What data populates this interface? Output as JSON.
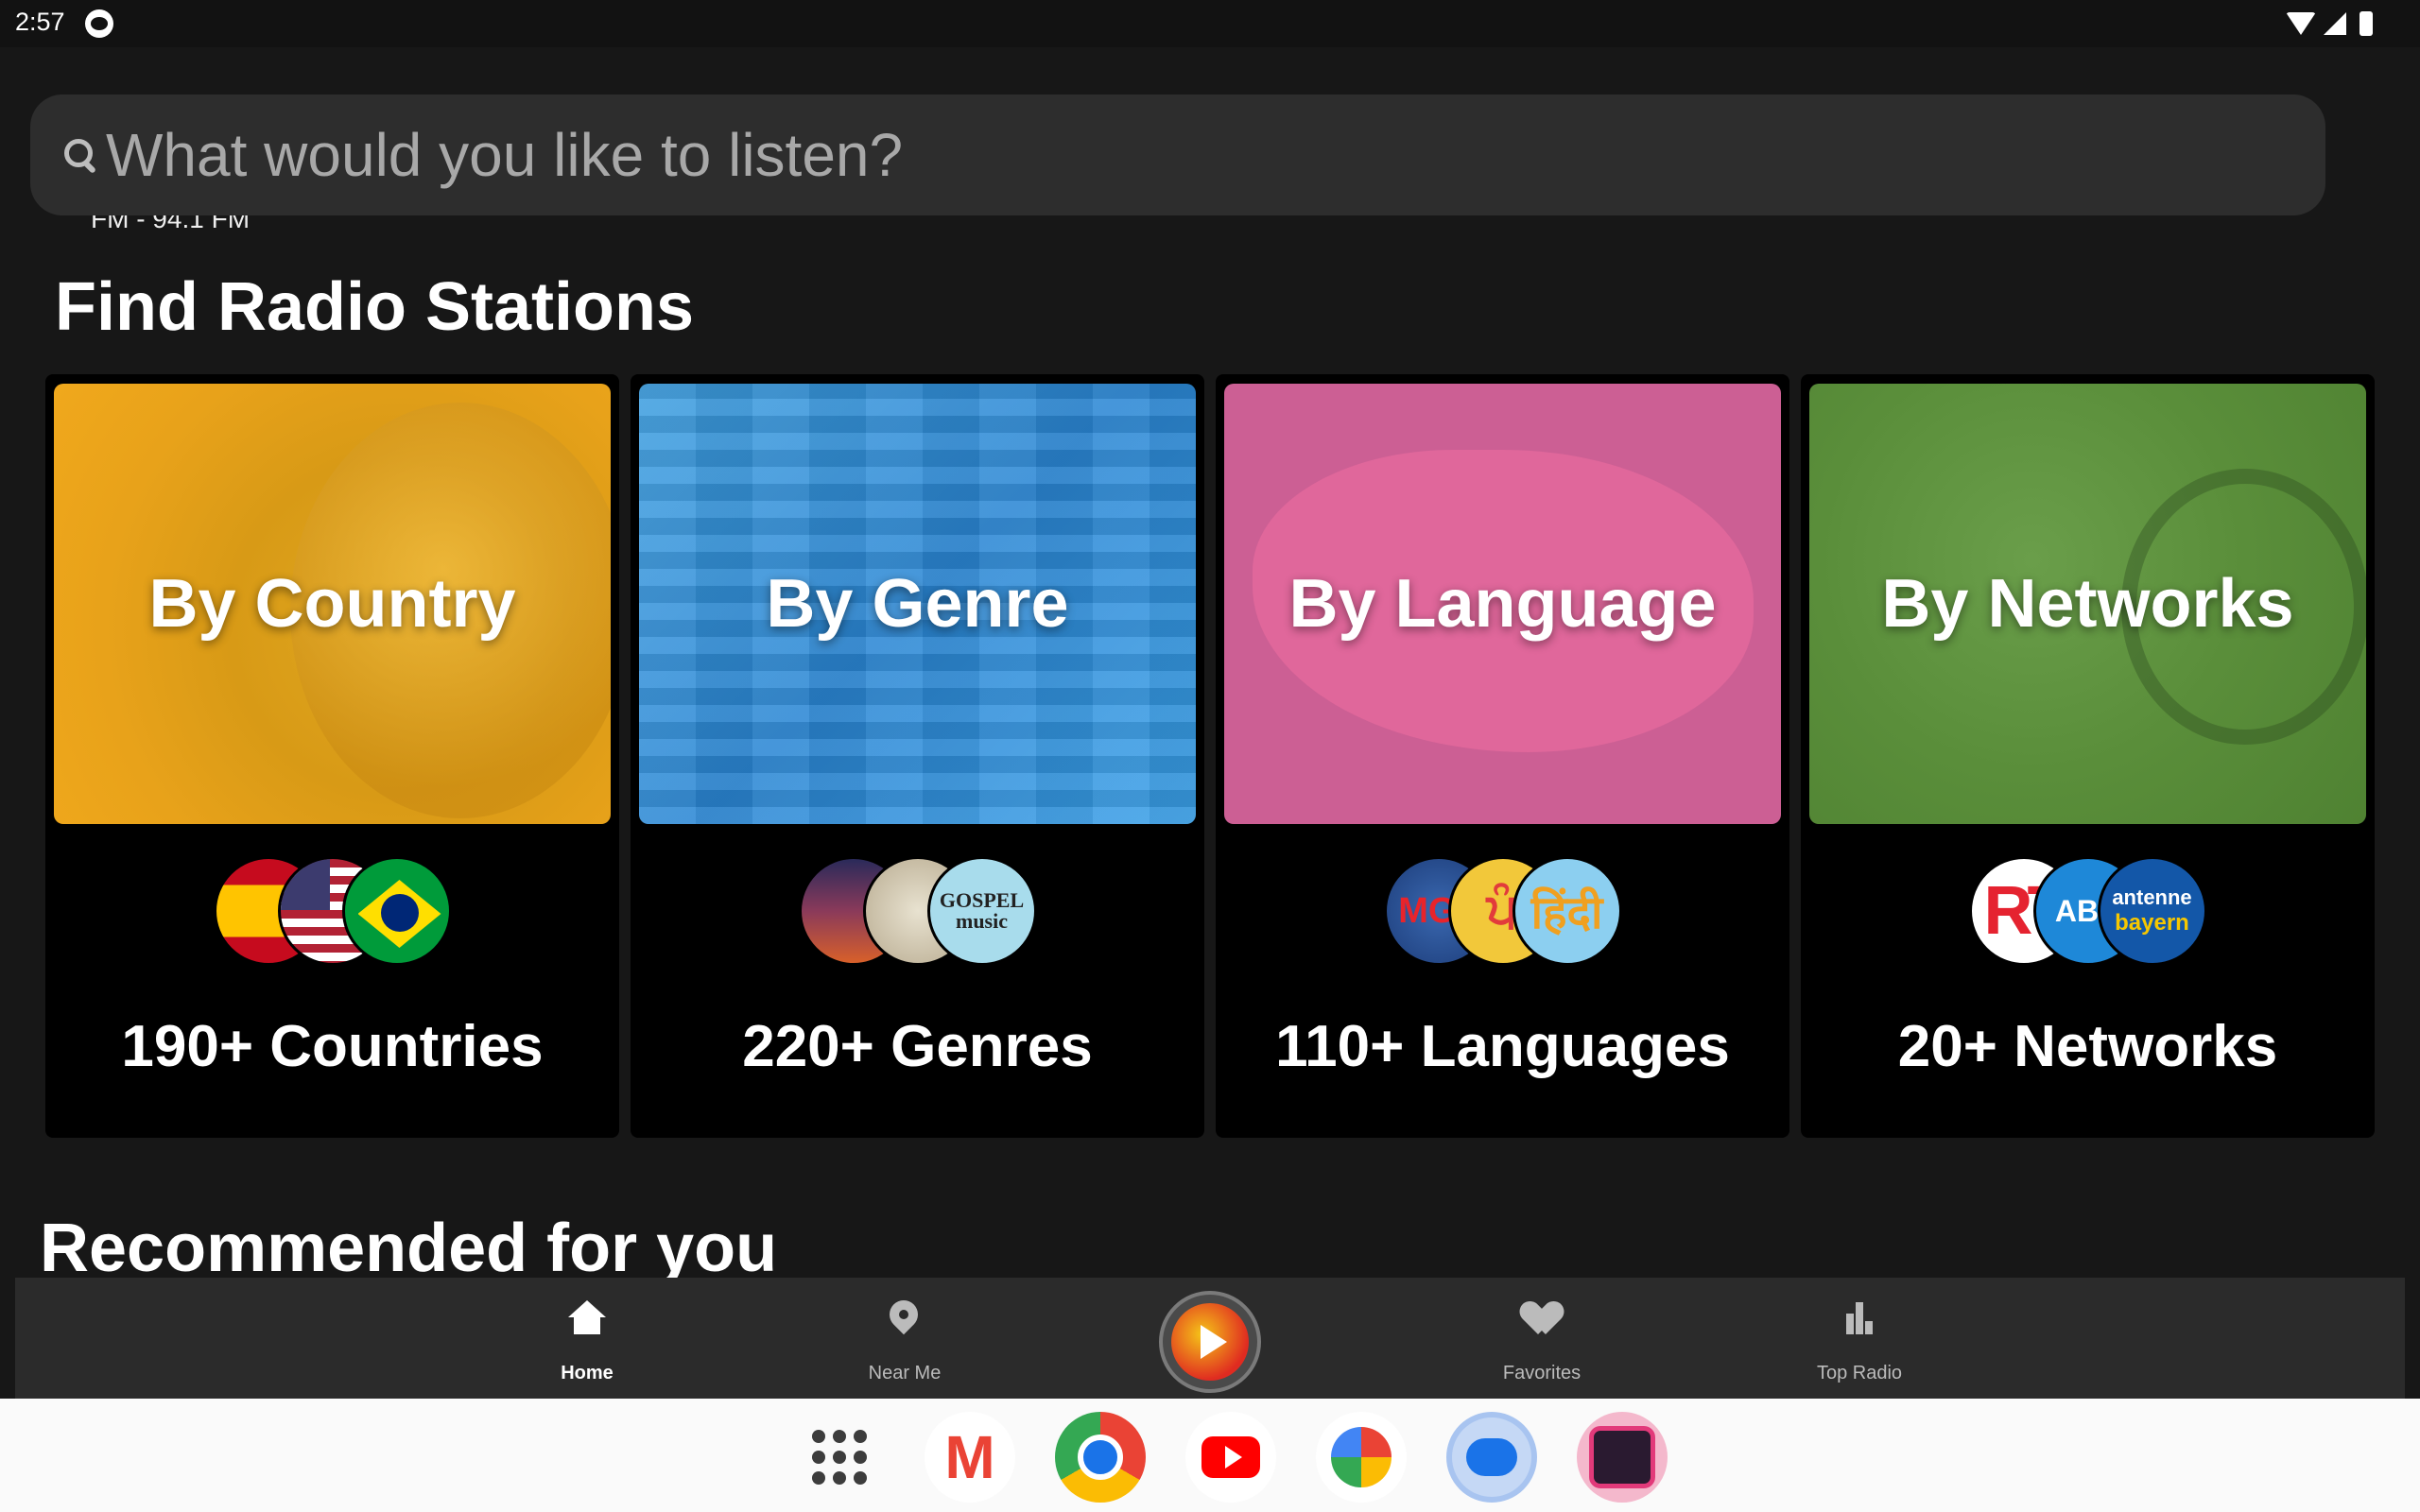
{
  "status_bar": {
    "time": "2:57"
  },
  "search": {
    "placeholder": "What would you like to listen?"
  },
  "peek_text": "FM - 94.1 FM",
  "sections": {
    "find_title": "Find Radio Stations",
    "recommended_title": "Recommended for you"
  },
  "cards": [
    {
      "title": "By Country",
      "count": "190+ Countries",
      "logos": [
        "Spain flag",
        "USA flag",
        "Brazil flag"
      ]
    },
    {
      "title": "By Genre",
      "count": "220+ Genres",
      "logo_text": "GOSPEL music"
    },
    {
      "title": "By Language",
      "count": "110+ Languages",
      "logo_text": [
        "MGL",
        "ਪੰ",
        "हिंदी"
      ]
    },
    {
      "title": "By Networks",
      "count": "20+ Networks",
      "logo_text": [
        "RT",
        "ABC",
        "antenne",
        "bayern"
      ]
    }
  ],
  "bottom_nav": {
    "items": [
      {
        "label": "Home",
        "icon": "home-icon",
        "active": true
      },
      {
        "label": "Near Me",
        "icon": "location-pin-icon"
      },
      {
        "label": "Favorites",
        "icon": "heart-icon"
      },
      {
        "label": "Top Radio",
        "icon": "bar-chart-icon"
      }
    ],
    "play_button": {
      "icon": "play-icon"
    }
  },
  "dock": {
    "apps": [
      "App drawer",
      "Gmail",
      "Chrome",
      "YouTube",
      "Photos",
      "Messages",
      "Radio"
    ]
  }
}
